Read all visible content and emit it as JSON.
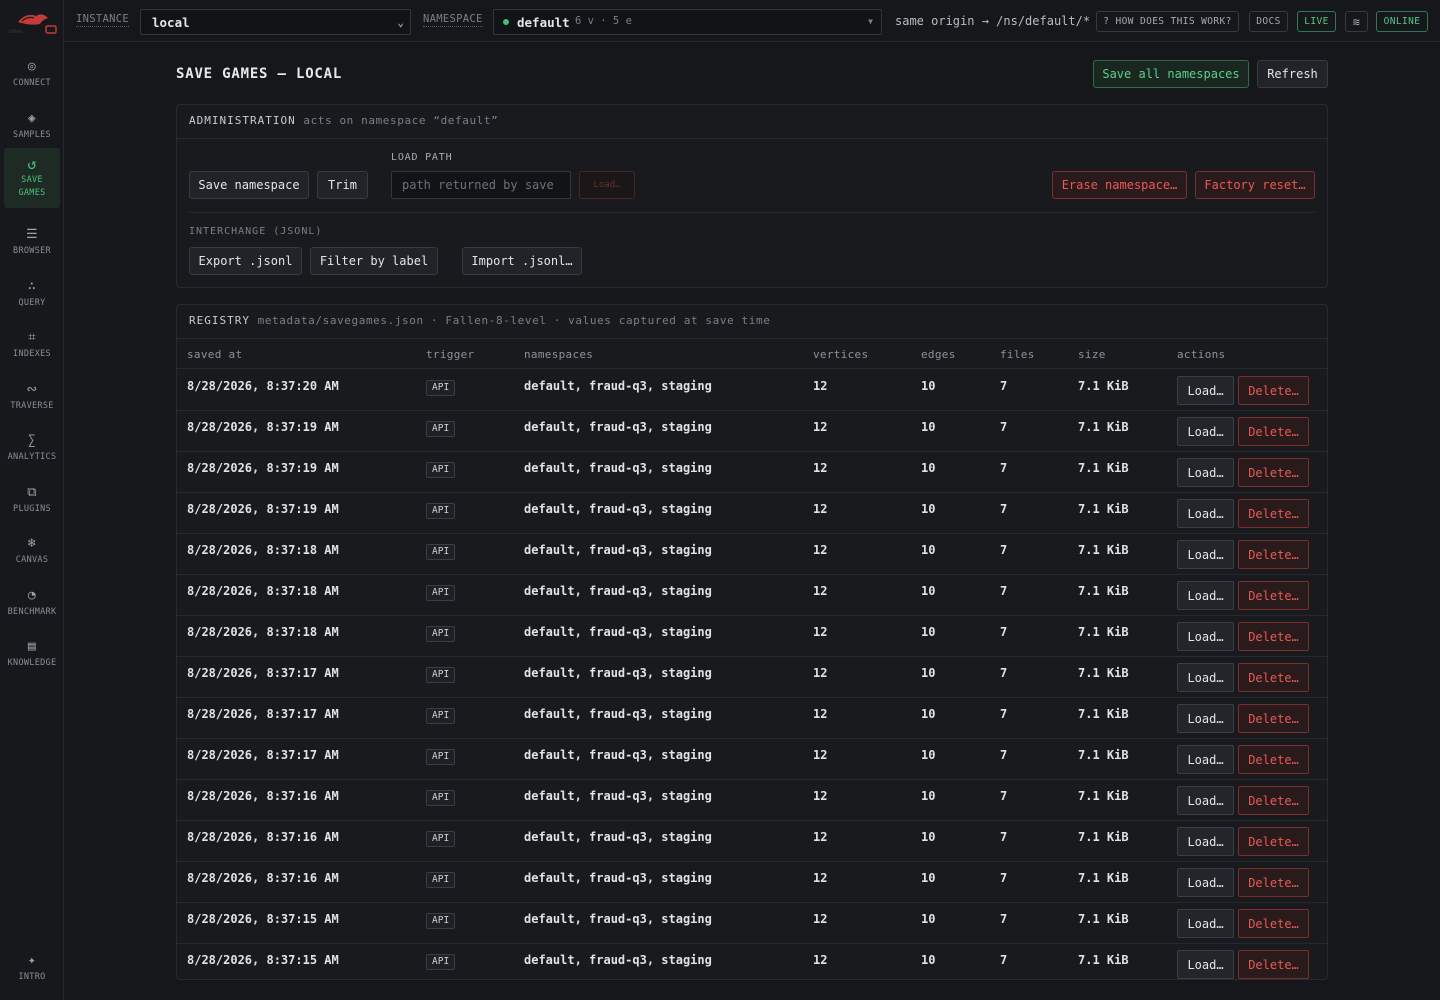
{
  "sidebar": {
    "items": [
      {
        "icon": "connect-icon",
        "glyph": "◎",
        "label": "CONNECT"
      },
      {
        "icon": "samples-icon",
        "glyph": "◈",
        "label": "SAMPLES"
      },
      {
        "icon": "save-games-icon",
        "glyph": "↺",
        "label": "SAVE\nGAMES"
      },
      {
        "icon": "browser-icon",
        "glyph": "☰",
        "label": "BROWSER"
      },
      {
        "icon": "query-icon",
        "glyph": "∴",
        "label": "QUERY"
      },
      {
        "icon": "indexes-icon",
        "glyph": "⌗",
        "label": "INDEXES"
      },
      {
        "icon": "traverse-icon",
        "glyph": "∾",
        "label": "TRAVERSE"
      },
      {
        "icon": "analytics-icon",
        "glyph": "∑",
        "label": "ANALYTICS"
      },
      {
        "icon": "plugins-icon",
        "glyph": "⧉",
        "label": "PLUGINS"
      },
      {
        "icon": "canvas-icon",
        "glyph": "❄",
        "label": "CANVAS"
      },
      {
        "icon": "benchmark-icon",
        "glyph": "◔",
        "label": "BENCHMARK"
      },
      {
        "icon": "knowledge-icon",
        "glyph": "▤",
        "label": "KNOWLEDGE"
      }
    ],
    "intro": {
      "icon": "intro-icon",
      "glyph": "✦",
      "label": "INTRO"
    }
  },
  "topbar": {
    "instance_label": "INSTANCE",
    "instance_value": "local",
    "namespace_label": "NAMESPACE",
    "namespace_value": "default",
    "namespace_counts": "6 v · 5 e",
    "origin": "same origin → /ns/default/*",
    "help": "? HOW DOES THIS WORK?",
    "docs": "DOCS",
    "live": "LIVE",
    "status": "ONLINE"
  },
  "page": {
    "title": "SAVE GAMES — LOCAL",
    "save_all": "Save all namespaces",
    "refresh": "Refresh"
  },
  "admin": {
    "title": "ADMINISTRATION",
    "subtitle": "acts on namespace “default”",
    "save_namespace": "Save namespace",
    "trim": "Trim",
    "load_path_label": "LOAD PATH",
    "load_path_placeholder": "path returned by save",
    "load": "Load…",
    "erase": "Erase namespace…",
    "factory_reset": "Factory reset…",
    "interchange_label": "INTERCHANGE (JSONL)",
    "export": "Export .jsonl",
    "filter": "Filter by label",
    "import": "Import .jsonl…"
  },
  "registry": {
    "title": "REGISTRY",
    "subtitle": "metadata/savegames.json · Fallen-8-level · values captured at save time",
    "columns": [
      "saved at",
      "trigger",
      "namespaces",
      "vertices",
      "edges",
      "files",
      "size",
      "actions"
    ],
    "load_label": "Load…",
    "delete_label": "Delete…",
    "rows": [
      {
        "saved_at": "8/28/2026, 8:37:20 AM",
        "trigger": "API",
        "namespaces": "default, fraud-q3, staging",
        "vertices": "12",
        "edges": "10",
        "files": "7",
        "size": "7.1 KiB"
      },
      {
        "saved_at": "8/28/2026, 8:37:19 AM",
        "trigger": "API",
        "namespaces": "default, fraud-q3, staging",
        "vertices": "12",
        "edges": "10",
        "files": "7",
        "size": "7.1 KiB"
      },
      {
        "saved_at": "8/28/2026, 8:37:19 AM",
        "trigger": "API",
        "namespaces": "default, fraud-q3, staging",
        "vertices": "12",
        "edges": "10",
        "files": "7",
        "size": "7.1 KiB"
      },
      {
        "saved_at": "8/28/2026, 8:37:19 AM",
        "trigger": "API",
        "namespaces": "default, fraud-q3, staging",
        "vertices": "12",
        "edges": "10",
        "files": "7",
        "size": "7.1 KiB"
      },
      {
        "saved_at": "8/28/2026, 8:37:18 AM",
        "trigger": "API",
        "namespaces": "default, fraud-q3, staging",
        "vertices": "12",
        "edges": "10",
        "files": "7",
        "size": "7.1 KiB"
      },
      {
        "saved_at": "8/28/2026, 8:37:18 AM",
        "trigger": "API",
        "namespaces": "default, fraud-q3, staging",
        "vertices": "12",
        "edges": "10",
        "files": "7",
        "size": "7.1 KiB"
      },
      {
        "saved_at": "8/28/2026, 8:37:18 AM",
        "trigger": "API",
        "namespaces": "default, fraud-q3, staging",
        "vertices": "12",
        "edges": "10",
        "files": "7",
        "size": "7.1 KiB"
      },
      {
        "saved_at": "8/28/2026, 8:37:17 AM",
        "trigger": "API",
        "namespaces": "default, fraud-q3, staging",
        "vertices": "12",
        "edges": "10",
        "files": "7",
        "size": "7.1 KiB"
      },
      {
        "saved_at": "8/28/2026, 8:37:17 AM",
        "trigger": "API",
        "namespaces": "default, fraud-q3, staging",
        "vertices": "12",
        "edges": "10",
        "files": "7",
        "size": "7.1 KiB"
      },
      {
        "saved_at": "8/28/2026, 8:37:17 AM",
        "trigger": "API",
        "namespaces": "default, fraud-q3, staging",
        "vertices": "12",
        "edges": "10",
        "files": "7",
        "size": "7.1 KiB"
      },
      {
        "saved_at": "8/28/2026, 8:37:16 AM",
        "trigger": "API",
        "namespaces": "default, fraud-q3, staging",
        "vertices": "12",
        "edges": "10",
        "files": "7",
        "size": "7.1 KiB"
      },
      {
        "saved_at": "8/28/2026, 8:37:16 AM",
        "trigger": "API",
        "namespaces": "default, fraud-q3, staging",
        "vertices": "12",
        "edges": "10",
        "files": "7",
        "size": "7.1 KiB"
      },
      {
        "saved_at": "8/28/2026, 8:37:16 AM",
        "trigger": "API",
        "namespaces": "default, fraud-q3, staging",
        "vertices": "12",
        "edges": "10",
        "files": "7",
        "size": "7.1 KiB"
      },
      {
        "saved_at": "8/28/2026, 8:37:15 AM",
        "trigger": "API",
        "namespaces": "default, fraud-q3, staging",
        "vertices": "12",
        "edges": "10",
        "files": "7",
        "size": "7.1 KiB"
      },
      {
        "saved_at": "8/28/2026, 8:37:15 AM",
        "trigger": "API",
        "namespaces": "default, fraud-q3, staging",
        "vertices": "12",
        "edges": "10",
        "files": "7",
        "size": "7.1 KiB"
      }
    ]
  },
  "colors": {
    "accent": "#4ac07f",
    "danger": "#e85a55",
    "bg": "#15171b"
  }
}
